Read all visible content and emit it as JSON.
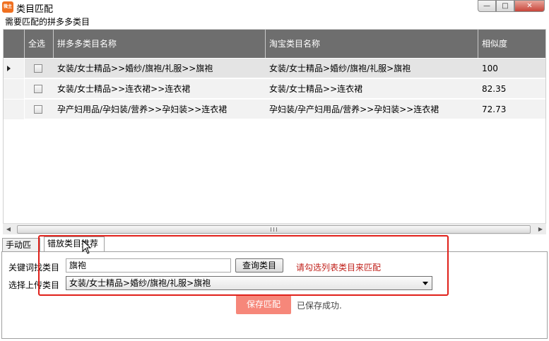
{
  "window": {
    "app_icon_text": "微主宝",
    "title": "类目匹配",
    "min_glyph": "—",
    "max_glyph": "□",
    "close_glyph": "✕"
  },
  "section_label": "需要匹配的拼多多类目",
  "grid": {
    "headers": {
      "select_all": "全选",
      "pdd_category": "拼多多类目名称",
      "taobao_category": "淘宝类目名称",
      "similarity": "相似度"
    },
    "rows": [
      {
        "pdd": "女装/女士精品>>婚纱/旗袍/礼服>>旗袍",
        "taobao": "女装/女士精品>婚纱/旗袍/礼服>旗袍",
        "similarity": "100",
        "selected": true
      },
      {
        "pdd": "女装/女士精品>>连衣裙>>连衣裙",
        "taobao": "女装/女士精品>>连衣裙",
        "similarity": "82.35",
        "selected": false
      },
      {
        "pdd": "孕产妇用品/孕妇装/营养>>孕妇装>>连衣裙",
        "taobao": "孕妇装/孕产妇用品/营养>>孕妇装>>连衣裙",
        "similarity": "72.73",
        "selected": false
      }
    ]
  },
  "scrollbar": {
    "left_glyph": "◀",
    "right_glyph": "▶"
  },
  "tabs": [
    {
      "label": "手动匹配",
      "active": false
    },
    {
      "label": "错放类目推荐",
      "active": true
    }
  ],
  "form": {
    "keyword_label": "关键词找类目",
    "keyword_value": "旗袍",
    "query_button": "查询类目",
    "hint": "请勾选列表类目来匹配",
    "upload_label": "选择上传类目",
    "upload_selected": "女装/女士精品>婚纱/旗袍/礼服>旗袍"
  },
  "save_button": "保存匹配",
  "status": "已保存成功.",
  "colors": {
    "header_bg": "#6e6e6e",
    "save_button_bg": "#f6877a",
    "hint_text": "#c0201a",
    "highlight_border": "#e0201a"
  }
}
